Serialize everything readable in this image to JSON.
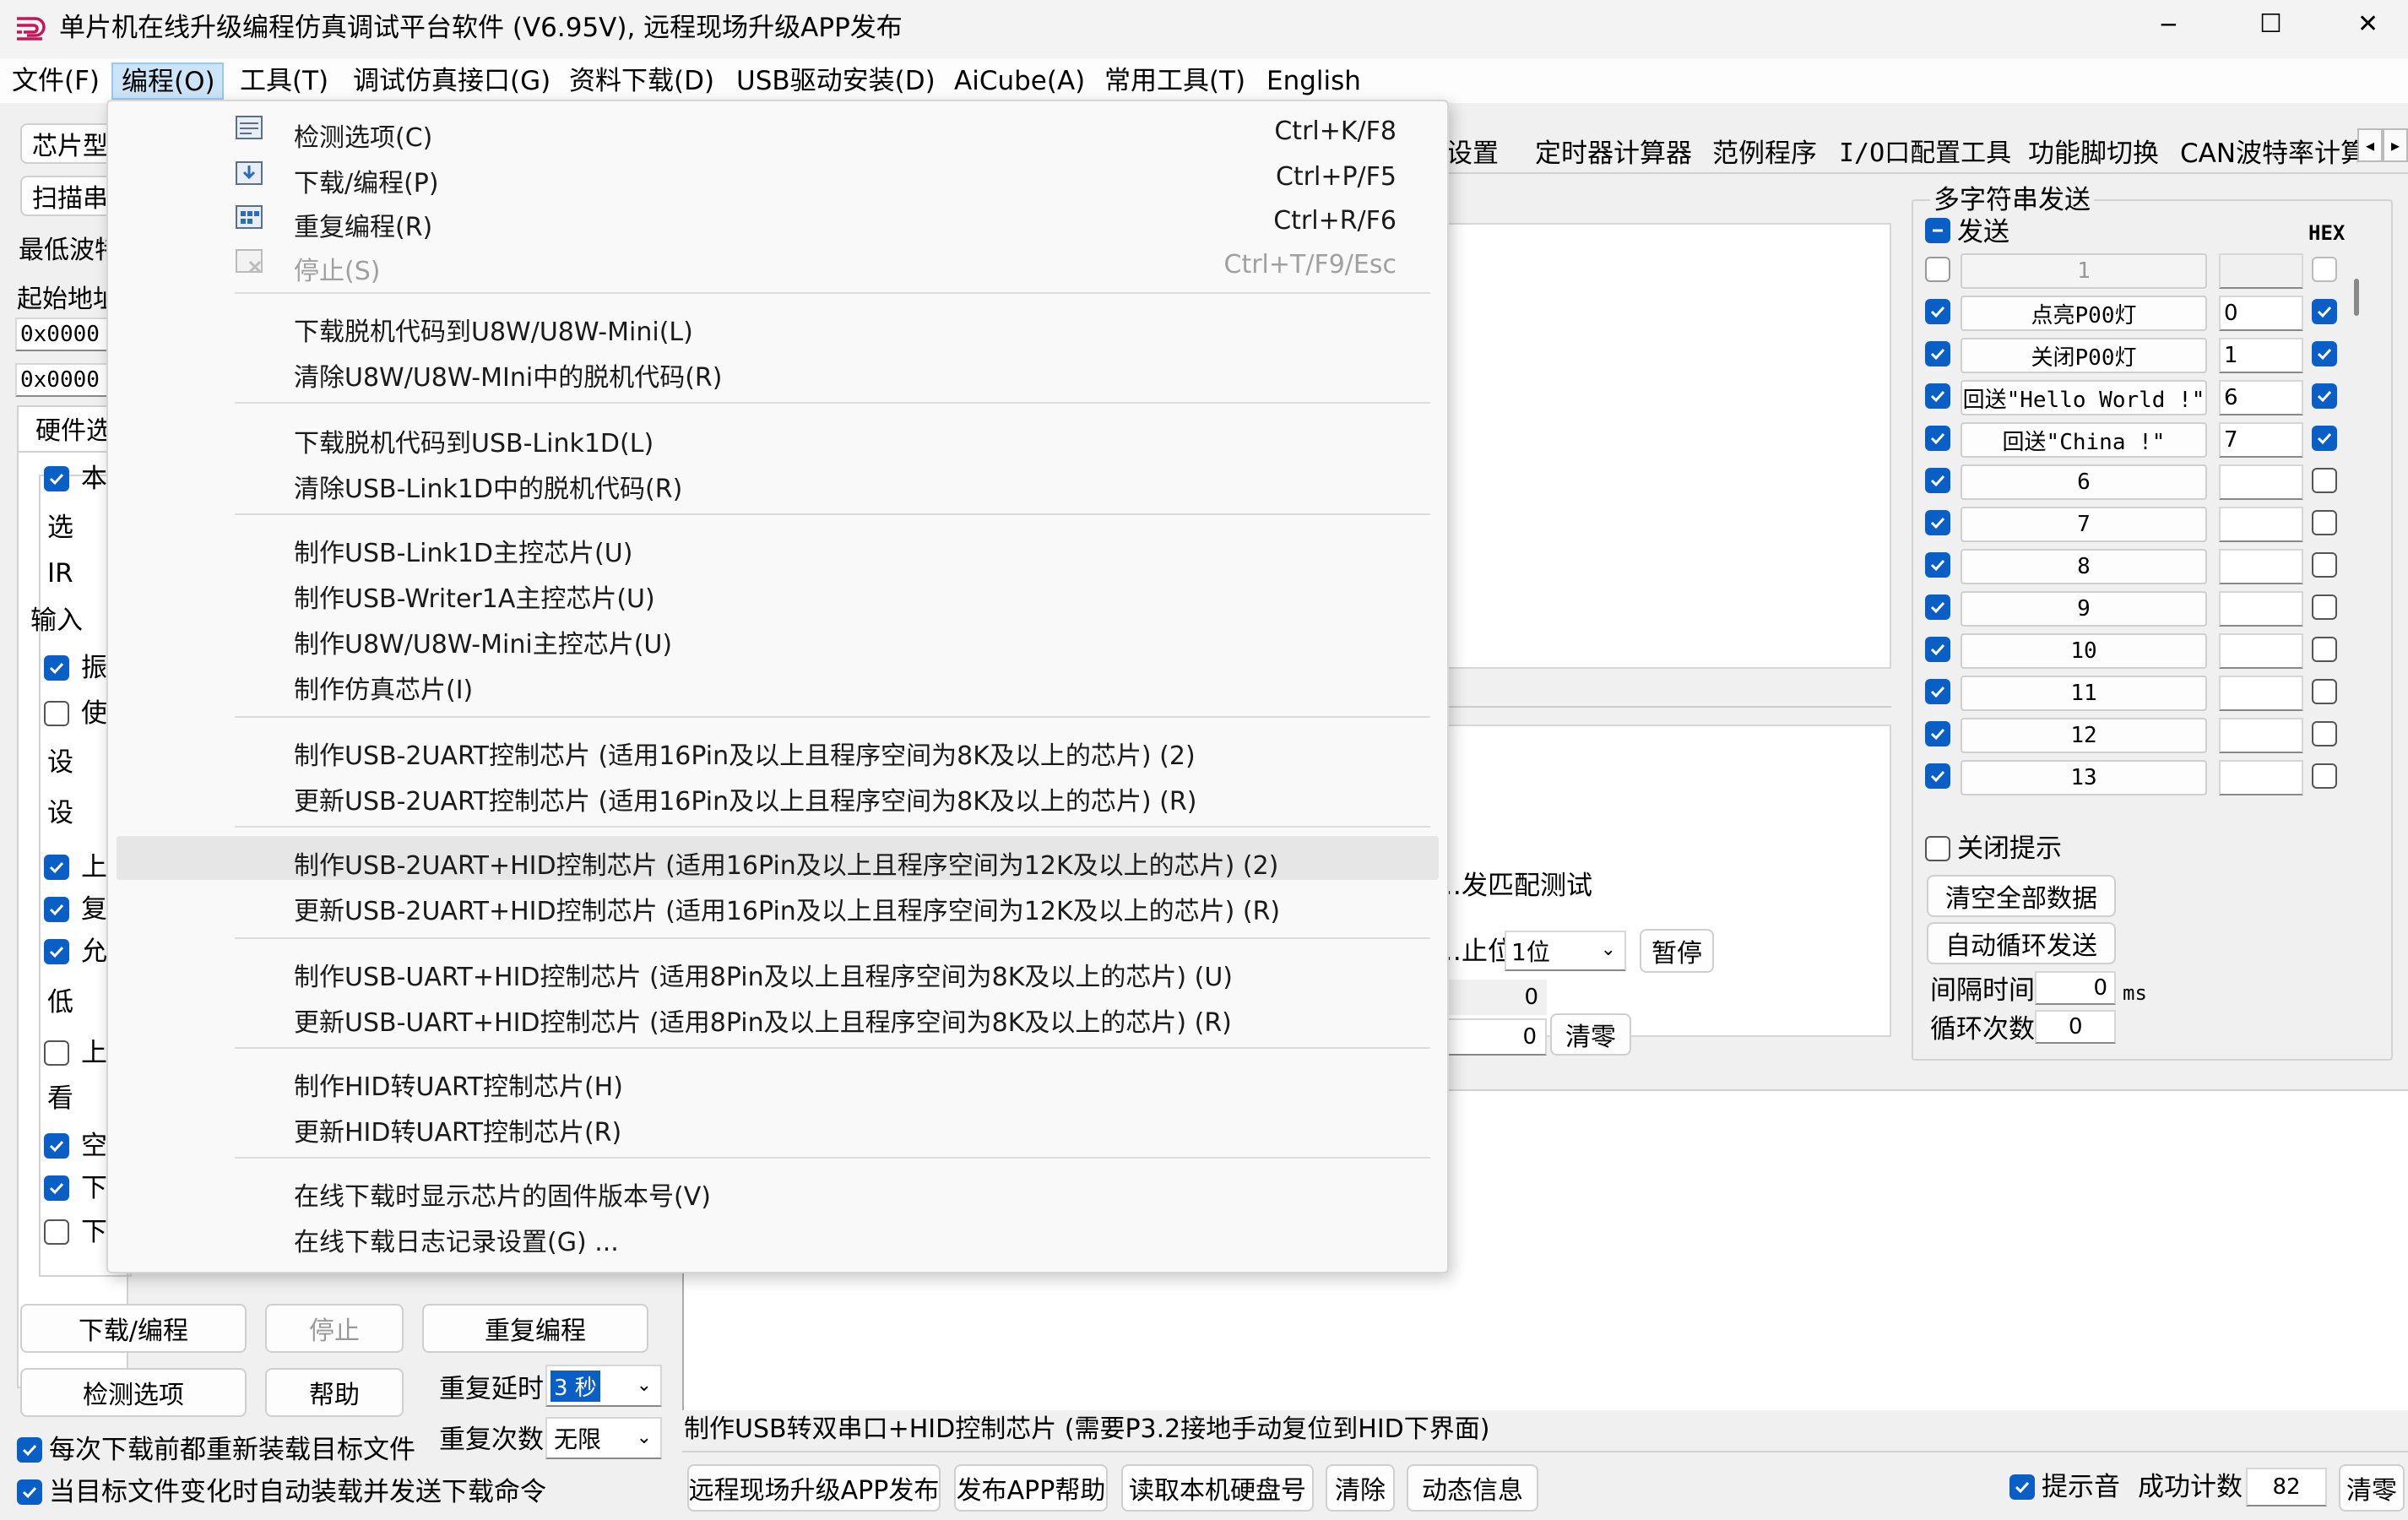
{
  "window": {
    "title": "单片机在线升级编程仿真调试平台软件 (V6.95V), 远程现场升级APP发布",
    "controls": {
      "minimize": "─",
      "maximize": "☐",
      "close": "✕"
    }
  },
  "menubar": [
    "文件(F)",
    "编程(O)",
    "工具(T)",
    "调试仿真接口(G)",
    "资料下载(D)",
    "USB驱动安装(D)",
    "AiCube(A)",
    "常用工具(T)",
    "English"
  ],
  "left": {
    "chip_label": "芯片型",
    "scan_label": "扫描串",
    "min_baud_label": "最低波特",
    "start_addr_label": "起始地址",
    "addr1": "0x0000",
    "addr2": "0x0000",
    "hw_tab": "硬件选",
    "options": [
      {
        "checked": true,
        "text": "本"
      },
      {
        "checked": null,
        "text": "选"
      },
      {
        "checked": null,
        "text": "IR"
      },
      {
        "checked": null,
        "text": "输入"
      },
      {
        "checked": true,
        "text": "振"
      },
      {
        "checked": false,
        "text": "使"
      },
      {
        "checked": null,
        "text": "设"
      },
      {
        "checked": null,
        "text": "设"
      },
      {
        "checked": true,
        "text": "上"
      },
      {
        "checked": true,
        "text": "复"
      },
      {
        "checked": true,
        "text": "允"
      },
      {
        "checked": null,
        "text": "低"
      },
      {
        "checked": false,
        "text": "上"
      },
      {
        "checked": null,
        "text": "看"
      },
      {
        "checked": true,
        "text": "空"
      },
      {
        "checked": true,
        "text": "下"
      },
      {
        "checked": false,
        "text": "下"
      }
    ],
    "download_button": "下载/编程",
    "stop_button": "停止",
    "repeat_button": "重复编程",
    "check_button": "检测选项",
    "help_button": "帮助",
    "repeat_delay_label": "重复延时",
    "repeat_delay_value": "3 秒",
    "repeat_count_label": "重复次数",
    "repeat_count_value": "无限",
    "reload_each_label": "每次下载前都重新装载目标文件",
    "auto_reload_label": "当目标文件变化时自动装载并发送下载命令"
  },
  "tabs": {
    "visible": [
      "…设置",
      "定时器计算器",
      "范例程序",
      "I/O口配置工具",
      "功能脚切换",
      "CAN波特率计算"
    ],
    "scroll_left": "◂",
    "scroll_right": "▸"
  },
  "serial": {
    "match_test_label": "…发匹配测试",
    "stop_bits_label": "…止位",
    "stop_bits_value": "1位",
    "pause_button": "暂停",
    "count1": "0",
    "count2": "0",
    "clear_button": "清零"
  },
  "multi_send": {
    "group_title": "多字符串发送",
    "send_label": "发送",
    "hex_label": "HEX",
    "rows": [
      {
        "checked": false,
        "label": "1",
        "value": "",
        "hex": false,
        "disabled": true
      },
      {
        "checked": true,
        "label": "点亮P00灯",
        "value": "0",
        "hex": true
      },
      {
        "checked": true,
        "label": "关闭P00灯",
        "value": "1",
        "hex": true
      },
      {
        "checked": true,
        "label": "回送\"Hello World !\"",
        "value": "6",
        "hex": true
      },
      {
        "checked": true,
        "label": "回送\"China !\"",
        "value": "7",
        "hex": true
      },
      {
        "checked": true,
        "label": "6",
        "value": "",
        "hex": false
      },
      {
        "checked": true,
        "label": "7",
        "value": "",
        "hex": false
      },
      {
        "checked": true,
        "label": "8",
        "value": "",
        "hex": false
      },
      {
        "checked": true,
        "label": "9",
        "value": "",
        "hex": false
      },
      {
        "checked": true,
        "label": "10",
        "value": "",
        "hex": false
      },
      {
        "checked": true,
        "label": "11",
        "value": "",
        "hex": false
      },
      {
        "checked": true,
        "label": "12",
        "value": "",
        "hex": false
      },
      {
        "checked": true,
        "label": "13",
        "value": "",
        "hex": false
      }
    ],
    "close_tip_label": "关闭提示",
    "clear_all_button": "清空全部数据",
    "auto_loop_button": "自动循环发送",
    "interval_label": "间隔时间",
    "interval_value": "0",
    "interval_unit": "ms",
    "loop_count_label": "循环次数",
    "loop_count_value": "0"
  },
  "status": {
    "message": "制作USB转双串口+HID控制芯片 (需要P3.2接地手动复位到HID下界面)",
    "buttons": [
      "远程现场升级APP发布",
      "发布APP帮助",
      "读取本机硬盘号",
      "清除",
      "动态信息"
    ],
    "sound_label": "提示音",
    "success_label": "成功计数",
    "success_value": "82",
    "clear_button": "清零"
  },
  "dropdown": {
    "items": [
      {
        "label": "检测选项(C)",
        "shortcut": "Ctrl+K/F8",
        "icon": "chip-check-icon"
      },
      {
        "label": "下载/编程(P)",
        "shortcut": "Ctrl+P/F5",
        "icon": "chip-download-icon"
      },
      {
        "label": "重复编程(R)",
        "shortcut": "Ctrl+R/F6",
        "icon": "chip-repeat-icon"
      },
      {
        "label": "停止(S)",
        "shortcut": "Ctrl+T/F9/Esc",
        "icon": "chip-stop-icon",
        "disabled": true
      },
      {
        "label": "下载脱机代码到U8W/U8W-Mini(L)"
      },
      {
        "label": "清除U8W/U8W-MIni中的脱机代码(R)"
      },
      {
        "label": "下载脱机代码到USB-Link1D(L)"
      },
      {
        "label": "清除USB-Link1D中的脱机代码(R)"
      },
      {
        "label": "制作USB-Link1D主控芯片(U)"
      },
      {
        "label": "制作USB-Writer1A主控芯片(U)"
      },
      {
        "label": "制作U8W/U8W-Mini主控芯片(U)"
      },
      {
        "label": "制作仿真芯片(I)"
      },
      {
        "label": "制作USB-2UART控制芯片 (适用16Pin及以上且程序空间为8K及以上的芯片) (2)"
      },
      {
        "label": "更新USB-2UART控制芯片 (适用16Pin及以上且程序空间为8K及以上的芯片) (R)"
      },
      {
        "label": "制作USB-2UART+HID控制芯片 (适用16Pin及以上且程序空间为12K及以上的芯片) (2)",
        "highlighted": true
      },
      {
        "label": "更新USB-2UART+HID控制芯片 (适用16Pin及以上且程序空间为12K及以上的芯片) (R)"
      },
      {
        "label": "制作USB-UART+HID控制芯片 (适用8Pin及以上且程序空间为8K及以上的芯片) (U)"
      },
      {
        "label": "更新USB-UART+HID控制芯片 (适用8Pin及以上且程序空间为8K及以上的芯片) (R)"
      },
      {
        "label": "制作HID转UART控制芯片(H)"
      },
      {
        "label": "更新HID转UART控制芯片(R)"
      },
      {
        "label": "在线下载时显示芯片的固件版本号(V)"
      },
      {
        "label": "在线下载日志记录设置(G) ..."
      }
    ]
  }
}
